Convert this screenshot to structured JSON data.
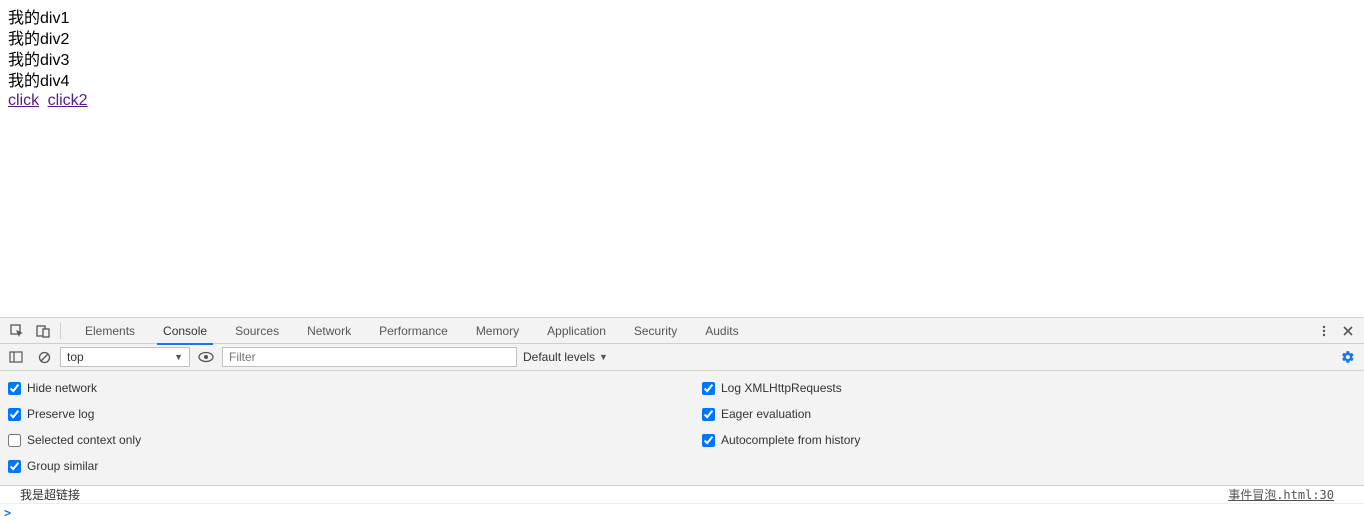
{
  "page": {
    "divs": [
      "我的div1",
      "我的div2",
      "我的div3",
      "我的div4"
    ],
    "links": [
      "click",
      "click2"
    ]
  },
  "devtools": {
    "tabs": [
      "Elements",
      "Console",
      "Sources",
      "Network",
      "Performance",
      "Memory",
      "Application",
      "Security",
      "Audits"
    ],
    "active_tab": "Console",
    "context_row": {
      "context_label": "top",
      "filter_placeholder": "Filter",
      "levels_label": "Default levels"
    },
    "settings": {
      "left": [
        {
          "label": "Hide network",
          "checked": true
        },
        {
          "label": "Preserve log",
          "checked": true
        },
        {
          "label": "Selected context only",
          "checked": false
        },
        {
          "label": "Group similar",
          "checked": true
        }
      ],
      "right": [
        {
          "label": "Log XMLHttpRequests",
          "checked": true
        },
        {
          "label": "Eager evaluation",
          "checked": true
        },
        {
          "label": "Autocomplete from history",
          "checked": true
        }
      ]
    },
    "console": {
      "message_text": "我是超链接",
      "message_source": "事件冒泡.html:30",
      "prompt": ">"
    }
  }
}
